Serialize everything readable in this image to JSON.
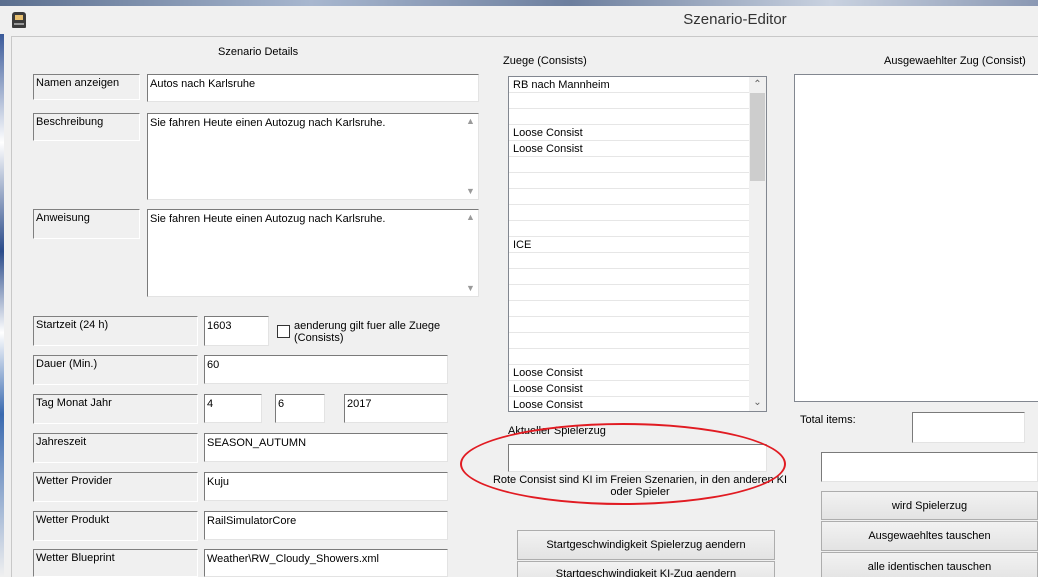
{
  "window": {
    "title": "Szenario-Editor"
  },
  "details": {
    "heading": "Szenario Details",
    "name": {
      "label": "Namen anzeigen",
      "value": "Autos nach Karlsruhe"
    },
    "description": {
      "label": "Beschreibung",
      "value": "Sie fahren Heute einen Autozug nach Karlsruhe."
    },
    "instruction": {
      "label": "Anweisung",
      "value": "Sie fahren Heute einen Autozug nach Karlsruhe."
    },
    "start_time": {
      "label": "Startzeit (24 h)",
      "value": "1603",
      "checkbox_label": "aenderung gilt fuer alle Zuege (Consists)"
    },
    "duration": {
      "label": "Dauer (Min.)",
      "value": "60"
    },
    "date": {
      "label": "Tag Monat Jahr",
      "day": "4",
      "month": "6",
      "year": "2017"
    },
    "season": {
      "label": "Jahreszeit",
      "value": "SEASON_AUTUMN"
    },
    "weather_provider": {
      "label": "Wetter Provider",
      "value": "Kuju"
    },
    "weather_product": {
      "label": "Wetter Produkt",
      "value": "RailSimulatorCore"
    },
    "weather_blueprint": {
      "label": "Wetter Blueprint",
      "value": "Weather\\RW_Cloudy_Showers.xml"
    }
  },
  "consists": {
    "heading": "Zuege (Consists)",
    "items": [
      "RB nach Mannheim",
      "",
      "",
      "Loose Consist",
      "Loose Consist",
      "",
      "",
      "",
      "",
      "",
      "ICE",
      "",
      "",
      "",
      "",
      "",
      "",
      "",
      "Loose Consist",
      "Loose Consist",
      "Loose Consist"
    ]
  },
  "player_train": {
    "label": "Aktueller Spielerzug",
    "value": "",
    "note": "Rote Consist sind KI im Freien Szenarien, in den anderen KI oder Spieler"
  },
  "speed_buttons": {
    "player_speed": "Startgeschwindigkeit Spielerzug aendern",
    "ai_speed": "Startgeschwindigkeit KI-Zug aendern"
  },
  "selected": {
    "heading": "Ausgewaehlter Zug (Consist)",
    "total_label": "Total items:",
    "total_value": "",
    "name_value": "",
    "become_player": "wird Spielerzug",
    "swap_selected": "Ausgewaehltes tauschen",
    "swap_identical": "alle identischen tauschen"
  },
  "colors": {
    "annotation": "#e11b22",
    "background": "#f0f0f0"
  }
}
